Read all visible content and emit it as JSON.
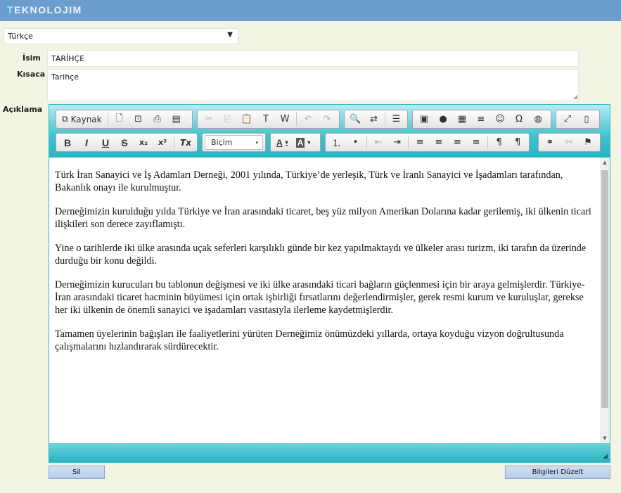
{
  "app": {
    "brand_first": "T",
    "brand_rest": "EKNOLOJIM"
  },
  "language": {
    "selected": "Türkçe",
    "arrow": "▼"
  },
  "form": {
    "name_label": "İsim",
    "name_value": "TARİHÇE",
    "short_label": "Kısaca",
    "short_value": "Tarihçe",
    "desc_label": "Açıklama"
  },
  "toolbar": {
    "source_label": "Kaynak",
    "format_label": "Biçim",
    "icons": {
      "source": "⧉",
      "new_page": "🗋",
      "preview": "⊡",
      "print": "⎙",
      "templates": "▤",
      "cut": "✂",
      "copy": "⎘",
      "paste": "📋",
      "paste_text": "T",
      "paste_word": "W",
      "undo": "↶",
      "redo": "↷",
      "find": "🔍",
      "replace": "⇄",
      "select_all": "☰",
      "image": "▣",
      "flash": "●",
      "table": "▦",
      "hline": "≡",
      "smiley": "☺",
      "omega": "Ω",
      "iframe": "◍",
      "maximize": "⤢",
      "blocks": "▯",
      "bold": "B",
      "italic": "I",
      "underline": "U",
      "strike": "S",
      "subscript": "x₂",
      "superscript": "x²",
      "remove_format": "Tx",
      "text_color": "A",
      "bg_color": "A",
      "ordered_list": "⒈",
      "bullet_list": "•",
      "outdent": "⇤",
      "indent": "⇥",
      "align_left": "≡",
      "align_center": "≡",
      "align_right": "≡",
      "justify": "≡",
      "ltr": "¶",
      "rtl": "¶",
      "link": "⚭",
      "unlink": "⚯",
      "anchor": "⚑",
      "dropdown": "▾"
    }
  },
  "editor": {
    "paragraphs": [
      "Türk İran Sanayici ve İş Adamları Derneği, 2001 yılında, Türkiye’de yerleşik, Türk ve İranlı Sanayici ve İşadamları tarafından, Bakanlık onayı ile kurulmuştur.",
      "Derneğimizin kurulduğu yılda Türkiye ve İran arasındaki ticaret, beş yüz milyon Amerikan Dolarına kadar gerilemiş, iki ülkenin ticari ilişkileri son derece zayıflamıştı.",
      "Yine o tarihlerde iki ülke arasında uçak seferleri karşılıklı günde bir kez yapılmaktaydı ve ülkeler arası turizm, iki tarafın da üzerinde durduğu bir konu değildi.",
      "Derneğimizin kurucuları bu tablonun değişmesi ve iki ülke arasındaki ticari bağların güçlenmesi için bir araya gelmişlerdir. Türkiye-İran arasındaki ticaret hacminin büyümesi için ortak işbirliği fırsatlarını değerlendirmişler, gerek resmi kurum ve kuruluşlar, gerekse her iki ülkenin de önemli sanayici ve işadamları vasıtasıyla ilerleme kaydetmişlerdir.",
      "Tamamen üyelerinin bağışları ile faaliyetlerini yürüten Derneğimiz önümüzdeki yıllarda, ortaya koyduğu vizyon doğrultusunda çalışmalarını hızlandırarak sürdürecektir."
    ],
    "scroll_up": "▲",
    "scroll_down": "▼",
    "resize": "◢"
  },
  "actions": {
    "delete_label": "Sil",
    "save_label": "Bilgileri Düzelt"
  },
  "colors": {
    "topbar": "#6c9ecd",
    "toolbar": "#3fc2cf",
    "page_bg": "#f4f4e4",
    "button": "#b6cde9"
  }
}
